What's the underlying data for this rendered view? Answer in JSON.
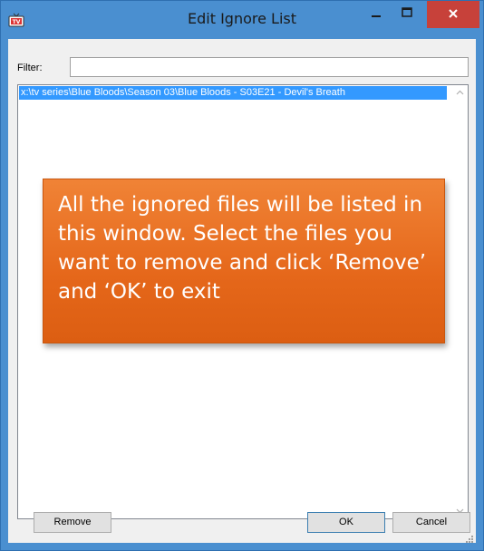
{
  "window": {
    "title": "Edit Ignore List",
    "icon": "tv-icon",
    "controls": [
      "minimize-icon",
      "maximize-icon",
      "close-icon"
    ],
    "accent_color": "#4a8fd0",
    "close_color": "#c7413a"
  },
  "filter": {
    "label": "Filter:",
    "value": "",
    "placeholder": ""
  },
  "list": {
    "items": [
      {
        "text": "x:\\tv series\\Blue Bloods\\Season 03\\Blue Bloods - S03E21 - Devil's Breath",
        "selected": true
      }
    ],
    "selection_color": "#3399ff",
    "scroll_up_icon": "chevron-up-icon",
    "scroll_down_icon": "chevron-down-icon"
  },
  "callout": {
    "text": "All the ignored files will be listed in this window. Select the files you want to remove and click ‘Remove’ and ‘OK’ to exit",
    "color": "#e5671a"
  },
  "buttons": {
    "remove_label": "Remove",
    "ok_label": "OK",
    "cancel_label": "Cancel"
  }
}
